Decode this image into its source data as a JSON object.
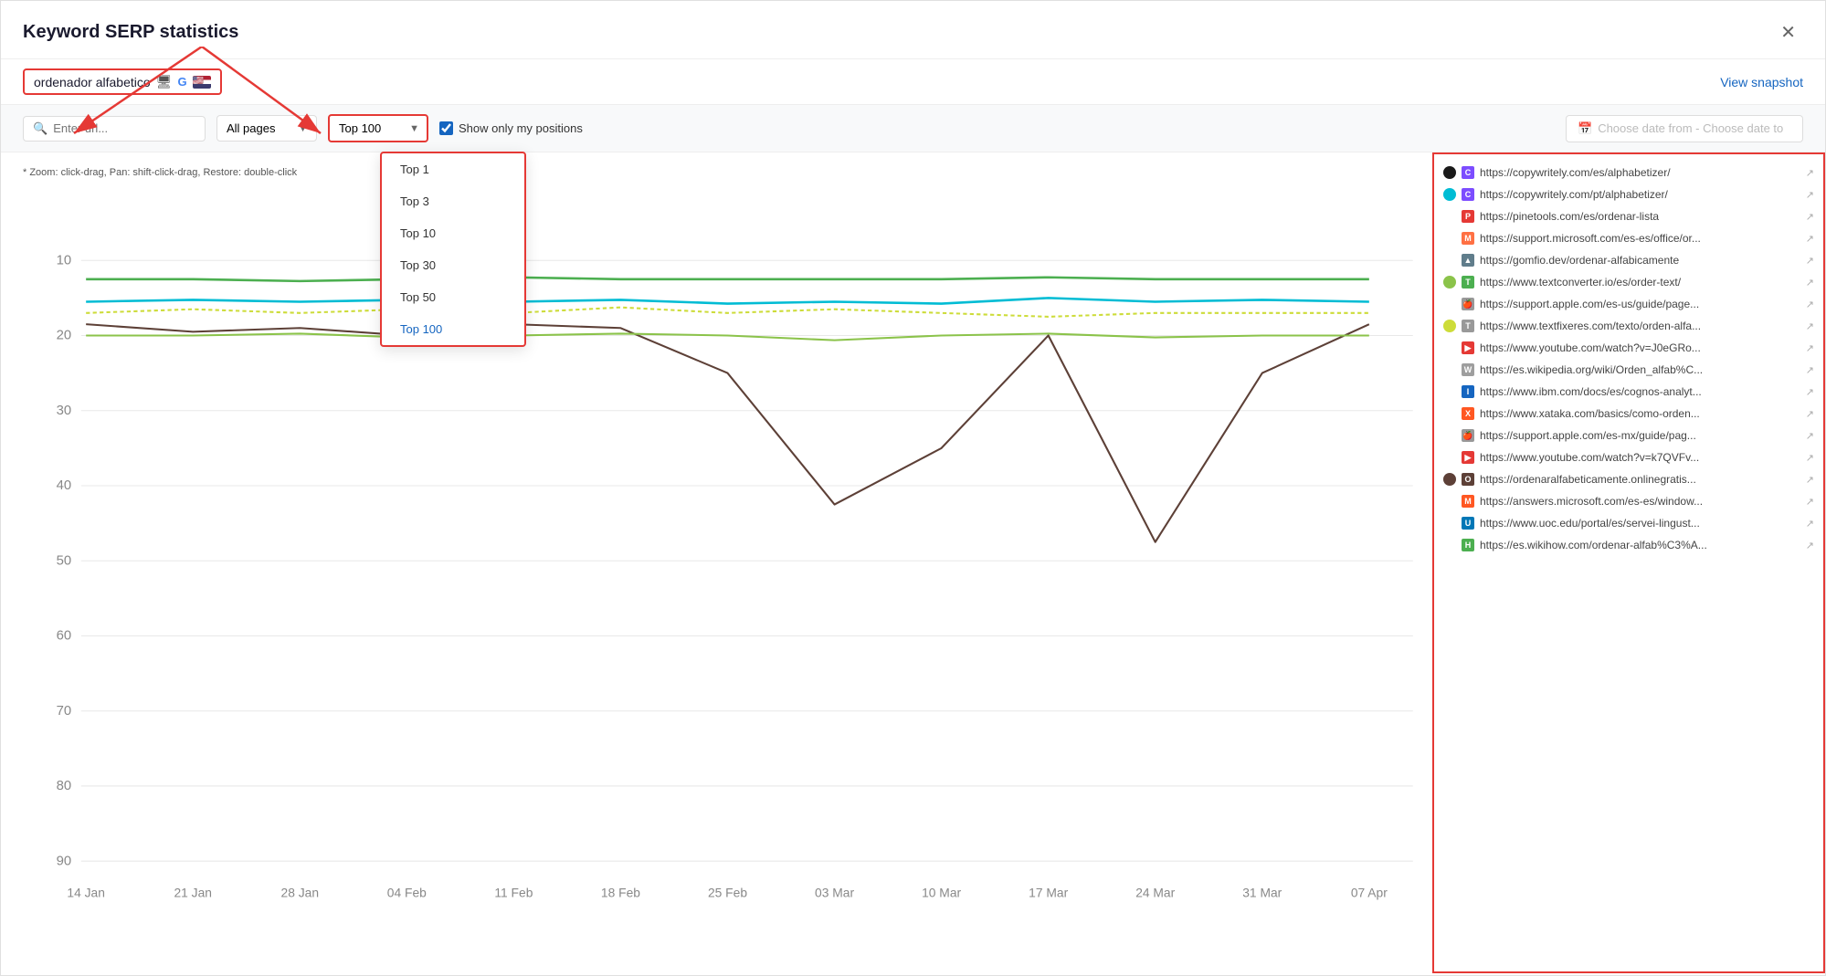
{
  "modal": {
    "title": "Keyword SERP statistics",
    "close_label": "✕"
  },
  "keyword": {
    "text": "ordenador alfabetico",
    "view_snapshot_label": "View snapshot"
  },
  "filters": {
    "url_placeholder": "Enter url...",
    "all_pages_label": "All pages",
    "top100_label": "Top 100",
    "show_only_my_positions_label": "Show only my positions",
    "date_placeholder": "Choose date from - Choose date to",
    "dropdown_options": [
      {
        "label": "Top 1",
        "value": "top1"
      },
      {
        "label": "Top 3",
        "value": "top3"
      },
      {
        "label": "Top 10",
        "value": "top10"
      },
      {
        "label": "Top 30",
        "value": "top30"
      },
      {
        "label": "Top 50",
        "value": "top50"
      },
      {
        "label": "Top 100",
        "value": "top100",
        "selected": true
      }
    ]
  },
  "chart": {
    "hint": "* Zoom: click-drag, Pan: shift-click-drag, Restore: double-click",
    "x_labels": [
      "14 Jan",
      "21 Jan",
      "28 Jan",
      "04 Feb",
      "11 Feb",
      "18 Feb",
      "25 Feb",
      "03 Mar",
      "10 Mar",
      "17 Mar",
      "24 Mar",
      "31 Mar",
      "07 Apr"
    ],
    "y_labels": [
      10,
      20,
      30,
      40,
      50,
      60,
      70,
      80,
      90
    ]
  },
  "legend": {
    "items": [
      {
        "color": "#2d5016",
        "dash": true,
        "favicon_color": "#7c4dff",
        "favicon_char": "C",
        "url": "https://copywritely.com/es/alphabetizer/",
        "has_indicator": true,
        "indicator_color": "#1a1a1a"
      },
      {
        "color": "#00bcd4",
        "dash": true,
        "favicon_color": "#7c4dff",
        "favicon_char": "C",
        "url": "https://copywritely.com/pt/alphabetizer/",
        "has_indicator": true,
        "indicator_color": "#00bcd4"
      },
      {
        "color": null,
        "dash": false,
        "favicon_color": "#e53935",
        "favicon_char": "P",
        "url": "https://pinetools.com/es/ordenar-lista",
        "has_indicator": false,
        "indicator_color": null
      },
      {
        "color": null,
        "dash": false,
        "favicon_color": "#ff7043",
        "favicon_char": "M",
        "url": "https://support.microsoft.com/es-es/office/or...",
        "has_indicator": false,
        "indicator_color": null
      },
      {
        "color": null,
        "dash": false,
        "favicon_color": "#607d8b",
        "favicon_char": "▲",
        "url": "https://gomfio.dev/ordenar-alfabicamente",
        "has_indicator": false,
        "indicator_color": null
      },
      {
        "color": "#8bc34a",
        "dash": true,
        "favicon_color": "#4caf50",
        "favicon_char": "T",
        "url": "https://www.textconverter.io/es/order-text/",
        "has_indicator": true,
        "indicator_color": "#8bc34a"
      },
      {
        "color": null,
        "dash": false,
        "favicon_color": "#999",
        "favicon_char": "🍎",
        "url": "https://support.apple.com/es-us/guide/page...",
        "has_indicator": false,
        "indicator_color": null
      },
      {
        "color": "#cddc39",
        "dash": true,
        "favicon_color": "#999",
        "favicon_char": "T",
        "url": "https://www.textfixeres.com/texto/orden-alfa...",
        "has_indicator": true,
        "indicator_color": "#cddc39"
      },
      {
        "color": null,
        "dash": false,
        "favicon_color": "#e53935",
        "favicon_char": "▶",
        "url": "https://www.youtube.com/watch?v=J0eGRo...",
        "has_indicator": false,
        "indicator_color": null
      },
      {
        "color": null,
        "dash": false,
        "favicon_color": "#9e9e9e",
        "favicon_char": "W",
        "url": "https://es.wikipedia.org/wiki/Orden_alfab%C...",
        "has_indicator": false,
        "indicator_color": null
      },
      {
        "color": null,
        "dash": false,
        "favicon_color": "#1565c0",
        "favicon_char": "I",
        "url": "https://www.ibm.com/docs/es/cognos-analyt...",
        "has_indicator": false,
        "indicator_color": null
      },
      {
        "color": null,
        "dash": false,
        "favicon_color": "#ff5722",
        "favicon_char": "X",
        "url": "https://www.xataka.com/basics/como-orden...",
        "has_indicator": false,
        "indicator_color": null
      },
      {
        "color": null,
        "dash": false,
        "favicon_color": "#999",
        "favicon_char": "🍎",
        "url": "https://support.apple.com/es-mx/guide/pag...",
        "has_indicator": false,
        "indicator_color": null
      },
      {
        "color": null,
        "dash": false,
        "favicon_color": "#e53935",
        "favicon_char": "▶",
        "url": "https://www.youtube.com/watch?v=k7QVFv...",
        "has_indicator": false,
        "indicator_color": null
      },
      {
        "color": "#5d4037",
        "dash": true,
        "favicon_color": "#5d4037",
        "favicon_char": "O",
        "url": "https://ordenaralfabeticamente.onlinegratis...",
        "has_indicator": true,
        "indicator_color": "#5d4037"
      },
      {
        "color": null,
        "dash": false,
        "favicon_color": "#ff5722",
        "favicon_char": "M",
        "url": "https://answers.microsoft.com/es-es/window...",
        "has_indicator": false,
        "indicator_color": null
      },
      {
        "color": null,
        "dash": false,
        "favicon_color": "#0077b6",
        "favicon_char": "U",
        "url": "https://www.uoc.edu/portal/es/servei-lingust...",
        "has_indicator": false,
        "indicator_color": null
      },
      {
        "color": null,
        "dash": false,
        "favicon_color": "#4caf50",
        "favicon_char": "H",
        "url": "https://es.wikihow.com/ordenar-alfab%C3%A...",
        "has_indicator": false,
        "indicator_color": null
      }
    ]
  }
}
